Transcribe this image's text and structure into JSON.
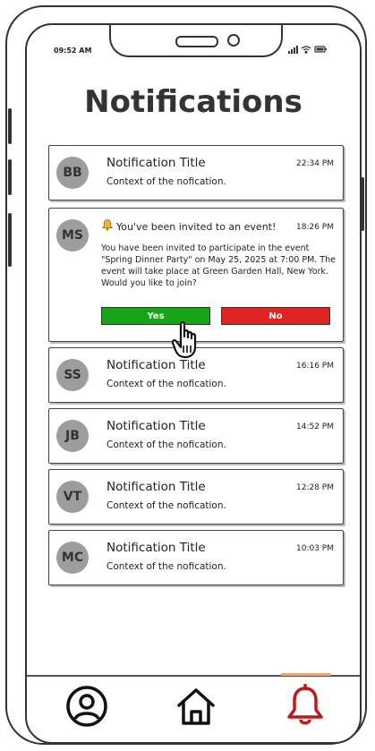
{
  "status_bar": {
    "time": "09:52 AM",
    "indicators": "signal wifi battery"
  },
  "page": {
    "title": "Notifications"
  },
  "notifications": [
    {
      "initials": "BB",
      "title": "Notification Title",
      "time": "22:34 PM",
      "context": "Context of the nofication."
    },
    {
      "initials": "MS",
      "title": "You've been invited to an event!",
      "time": "18:26 PM",
      "body": "You have been invited to participate in the event \"Spring Dinner Party\" on May 25, 2025 at 7:00 PM. The event will take place at Green Garden Hall, New York. Would you like to join?",
      "yes_label": "Yes",
      "no_label": "No"
    },
    {
      "initials": "SS",
      "title": "Notification Title",
      "time": "16:16 PM",
      "context": "Context of the nofication."
    },
    {
      "initials": "JB",
      "title": "Notification Title",
      "time": "14:52 PM",
      "context": "Context of the nofication."
    },
    {
      "initials": "VT",
      "title": "Notification Title",
      "time": "12:28 PM",
      "context": "Context of the nofication."
    },
    {
      "initials": "MC",
      "title": "Notification Title",
      "time": "10:03 PM",
      "context": "Context of the nofication."
    }
  ],
  "nav": {
    "items": [
      "profile-icon",
      "home-icon",
      "bell-icon"
    ],
    "active": "bell-icon"
  },
  "colors": {
    "yes": "#16a516",
    "no": "#e02323",
    "active_nav": "#c01818",
    "nav_accent": "#f0a574"
  }
}
